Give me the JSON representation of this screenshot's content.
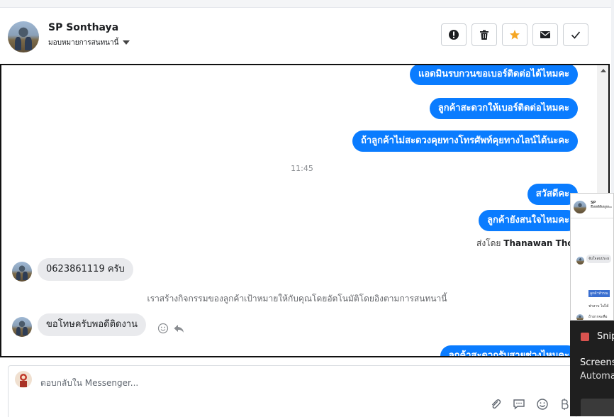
{
  "header": {
    "contact_name": "SP Sonthaya",
    "assign_label": "มอบหมายการสนทนานี้",
    "actions": [
      {
        "name": "spam-button",
        "icon": "alert-icon"
      },
      {
        "name": "delete-button",
        "icon": "trash-icon"
      },
      {
        "name": "star-button",
        "icon": "star-icon",
        "color": "#f5a623"
      },
      {
        "name": "mark-unread-button",
        "icon": "envelope-icon"
      },
      {
        "name": "done-button",
        "icon": "check-icon"
      }
    ]
  },
  "messages": {
    "out1": "แอดมินรบกวนขอเบอร์ติดต่อได้ไหมคะ",
    "out2": "ลูกค้าสะดวกให้เบอร์ติดต่อไหมคะ",
    "out3": "ถ้าลูกค้าไม่สะดวงคุยทางโทรศัพท์คุยทางไลน์ได้นะคะ",
    "time": "11:45",
    "out4": "สวัสดีคะ",
    "out5": "ลูกค้ายังสนใจไหมคะ",
    "sent_by_prefix": "ส่งโดย",
    "sent_by_name": "Thanawan Thon",
    "in1": "0623861119  ครับ",
    "system": "เราสร้างกิจกรรมของลูกค้าเป้าหมายให้กับคุณโดยอัตโนมัติโดยอิงตามการสนทนานี้",
    "in2": "ขอโทษครับพอดีติดงาน",
    "out6": "ลูกค้าสะดวกรับสายช่วงไหมคะ"
  },
  "composer": {
    "placeholder": "ตอบกลับใน Messenger..."
  },
  "overlay": {
    "name": "SP Sonthaya",
    "row1": "จับใจลบประย",
    "row2": "ลูกค้าหัวรณ",
    "row3": "ฟาลาบ ไม่ได้",
    "row4": "ถ้ายากจะคือ"
  },
  "snip": {
    "title": "Snip",
    "line1": "Screens",
    "line2": "Automa"
  },
  "colors": {
    "accent": "#0a7cff",
    "star": "#f5a623"
  }
}
